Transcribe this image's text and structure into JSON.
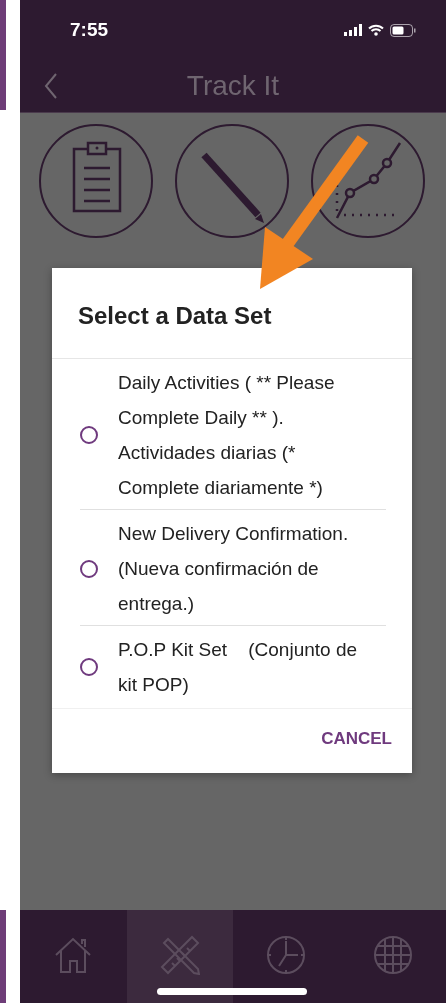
{
  "status_bar": {
    "time": "7:55"
  },
  "nav_bar": {
    "title": "Track It"
  },
  "dialog": {
    "title": "Select a Data Set",
    "options": [
      {
        "label": "Daily Activities ( ** Please Complete Daily ** ). Actividades diarias (* Complete diariamente *)",
        "selected": false
      },
      {
        "label": "New Delivery Confirmation. (Nueva confirmación de entrega.)",
        "selected": false
      },
      {
        "label": "P.O.P Kit Set    (Conjunto de kit POP)",
        "selected": false
      }
    ],
    "cancel": "CANCEL"
  },
  "tab_bar": [
    {
      "kind": "home",
      "selected": false
    },
    {
      "kind": "tools",
      "selected": true
    },
    {
      "kind": "clock",
      "selected": false
    },
    {
      "kind": "globe",
      "selected": false
    }
  ]
}
